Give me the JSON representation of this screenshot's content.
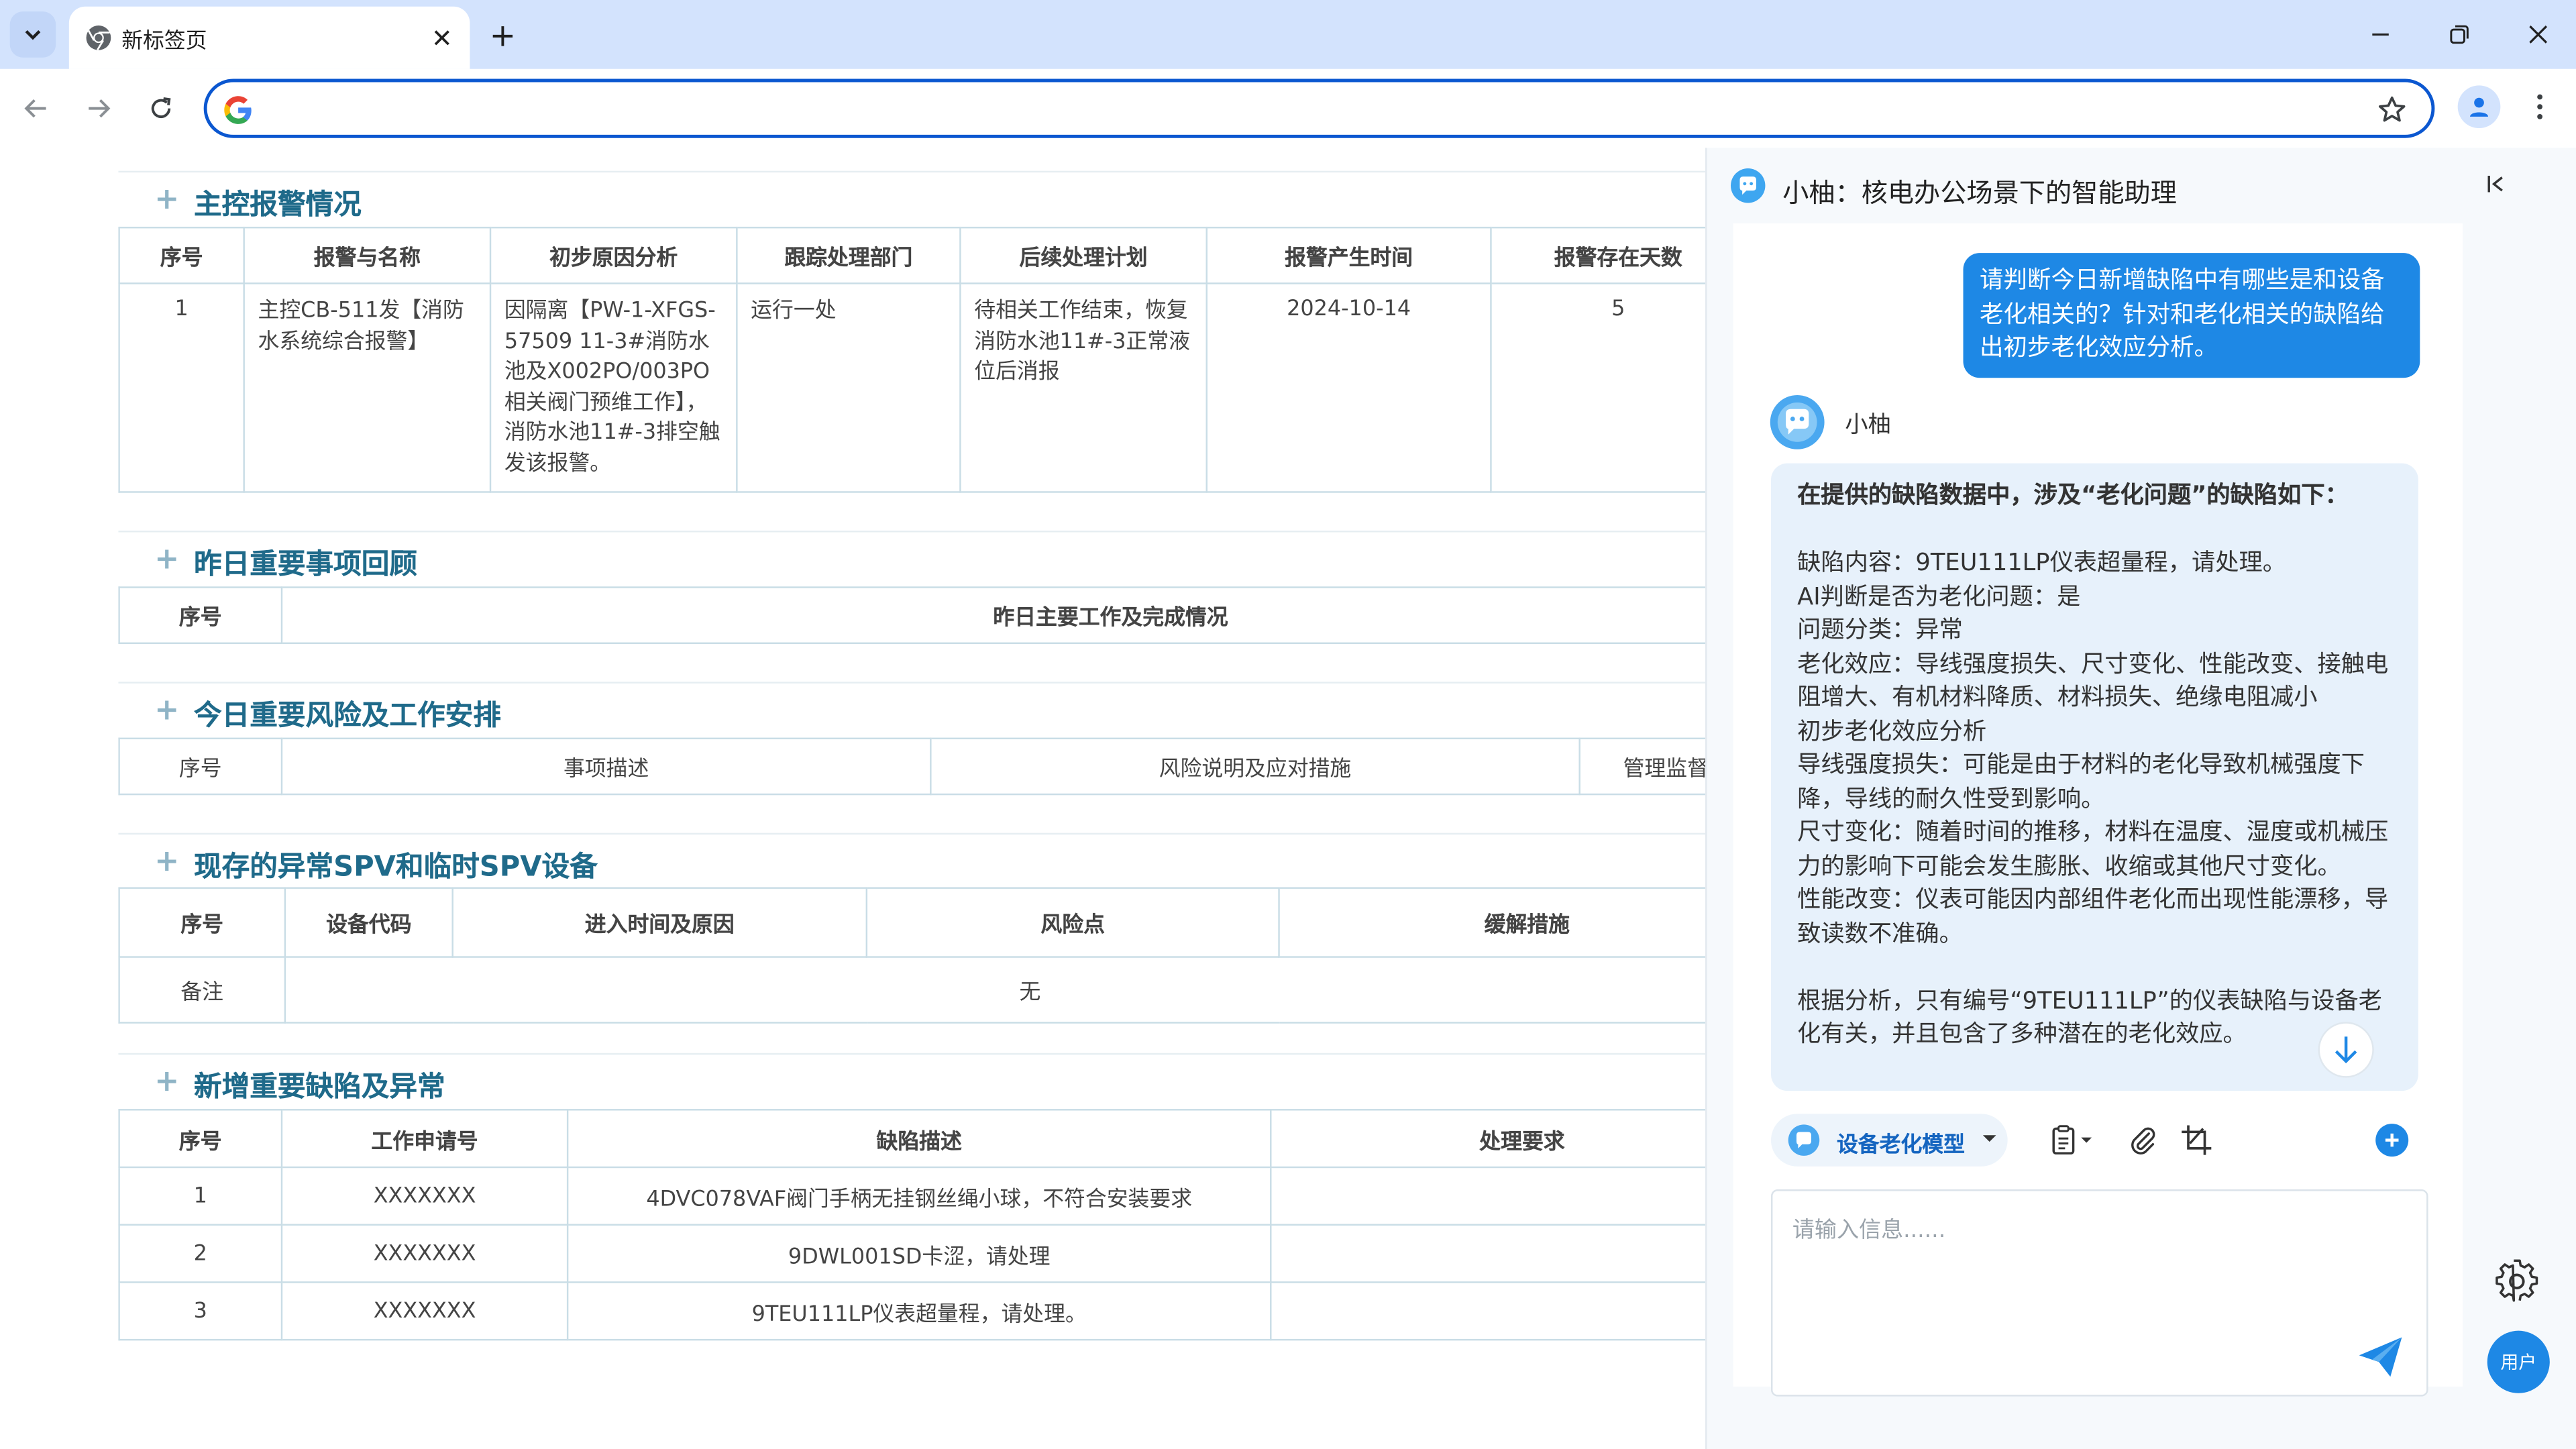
{
  "browser": {
    "tab_title": "新标签页",
    "url": "",
    "url_placeholder": ""
  },
  "report": {
    "sections": {
      "alarms": {
        "title": "主控报警情况",
        "headers": [
          "序号",
          "报警与名称",
          "初步原因分析",
          "跟踪处理部门",
          "后续处理计划",
          "报警产生时间",
          "报警存在天数"
        ],
        "rows": [
          [
            "1",
            "主控CB-511发【消防水系统综合报警】",
            "因隔离【PW-1-XFGS-57509 11-3#消防水池及X002PO/003PO相关阀门预维工作】，消防水池11#-3排空触发该报警。",
            "运行一处",
            "待相关工作结束，恢复消防水池11#-3正常液位后消报",
            "2024-10-14",
            "5"
          ]
        ]
      },
      "yesterday": {
        "title": "昨日重要事项回顾",
        "headers": [
          "序号",
          "昨日主要工作及完成情况"
        ]
      },
      "today_risks": {
        "title": "今日重要风险及工作安排",
        "headers": [
          "序号",
          "事项描述",
          "风险说明及应对措施",
          "管理监督"
        ]
      },
      "spv": {
        "title": "现存的异常SPV和临时SPV设备",
        "headers": [
          "序号",
          "设备代码",
          "进入时间及原因",
          "风险点",
          "缓解措施"
        ],
        "remark_label": "备注",
        "remark_value": "无"
      },
      "defects": {
        "title": "新增重要缺陷及异常",
        "headers": [
          "序号",
          "工作申请号",
          "缺陷描述",
          "处理要求"
        ],
        "rows": [
          [
            "1",
            "XXXXXXX",
            "4DVC078VAF阀门手柄无挂钢丝绳小球，不符合安装要求",
            ""
          ],
          [
            "2",
            "XXXXXXX",
            "9DWL001SD卡涩，请处理",
            ""
          ],
          [
            "3",
            "XXXXXXX",
            "9TEU111LP仪表超量程，请处理。",
            ""
          ]
        ]
      }
    }
  },
  "assistant": {
    "title": "小柚：核电办公场景下的智能助理",
    "user_message": "请判断今日新增缺陷中有哪些是和设备老化相关的？针对和老化相关的缺陷给出初步老化效应分析。",
    "bot_name": "小柚",
    "bot_lines": [
      "在提供的缺陷数据中，涉及“老化问题”的缺陷如下：",
      "",
      "缺陷内容：9TEU111LP仪表超量程，请处理。",
      "AI判断是否为老化问题：是",
      "问题分类：异常",
      "老化效应：导线强度损失、尺寸变化、性能改变、接触电阻增大、有机材料降质、材料损失、绝缘电阻减小",
      "初步老化效应分析",
      "导线强度损失：可能是由于材料的老化导致机械强度下降，导线的耐久性受到影响。",
      "尺寸变化：随着时间的推移，材料在温度、湿度或机械压力的影响下可能会发生膨胀、收缩或其他尺寸变化。",
      "性能改变：仪表可能因内部组件老化而出现性能漂移，导致读数不准确。",
      "",
      "根据分析，只有编号“9TEU111LP”的仪表缺陷与设备老化有关，并且包含了多种潜在的老化效应。"
    ],
    "model_label": "设备老化模型",
    "input_placeholder": "请输入信息......",
    "input_value": "",
    "user_button": "用户"
  }
}
